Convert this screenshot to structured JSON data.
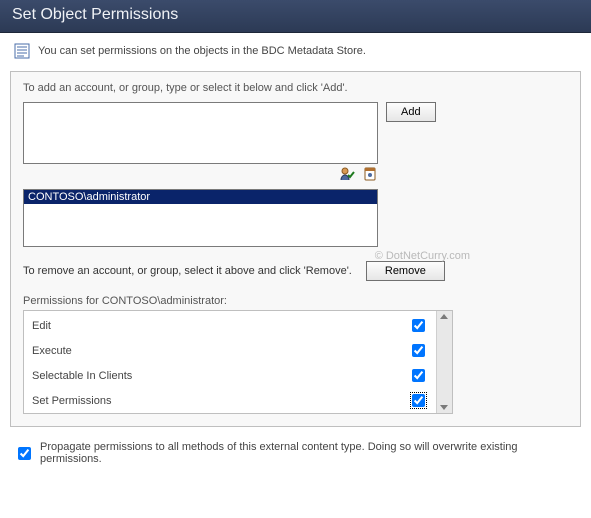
{
  "title": "Set Object Permissions",
  "description": "You can set permissions on the objects in the BDC Metadata Store.",
  "panel": {
    "add_instruction": "To add an account, or group, type or select it below and click 'Add'.",
    "add_button": "Add",
    "icons": {
      "check_names": "check-names-icon",
      "browse": "address-book-icon"
    },
    "selected_account": "CONTOSO\\administrator",
    "remove_instruction": "To remove an account, or group, select it above and click 'Remove'.",
    "remove_button": "Remove",
    "permissions_label": "Permissions for CONTOSO\\administrator:",
    "permissions": [
      {
        "name": "Edit",
        "checked": true
      },
      {
        "name": "Execute",
        "checked": true
      },
      {
        "name": "Selectable In Clients",
        "checked": true
      },
      {
        "name": "Set Permissions",
        "checked": true,
        "focused": true
      }
    ]
  },
  "propagate": {
    "label": "Propagate permissions to all methods of this external content type. Doing so will overwrite existing permissions.",
    "checked": true
  },
  "watermark": "© DotNetCurry.com"
}
